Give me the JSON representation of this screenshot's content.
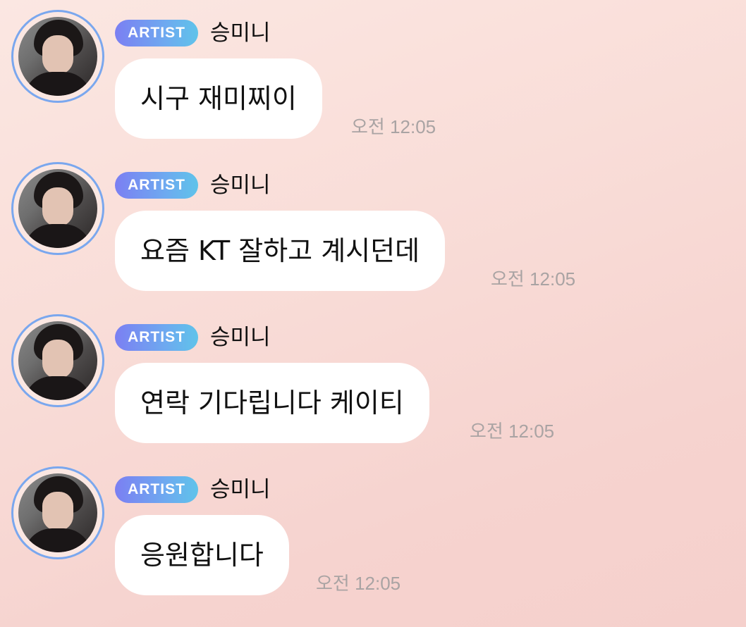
{
  "messages": [
    {
      "badge": "ARTIST",
      "sender": "승미니",
      "text": "시구 재미찌이",
      "time": "오전 12:05",
      "avatar_icon": "artist-avatar"
    },
    {
      "badge": "ARTIST",
      "sender": "승미니",
      "text": "요즘 KT 잘하고 계시던데",
      "time": "오전 12:05",
      "avatar_icon": "artist-avatar"
    },
    {
      "badge": "ARTIST",
      "sender": "승미니",
      "text": "연락 기다립니다 케이티",
      "time": "오전 12:05",
      "avatar_icon": "artist-avatar"
    },
    {
      "badge": "ARTIST",
      "sender": "승미니",
      "text": "응원합니다",
      "time": "오전 12:05",
      "avatar_icon": "artist-avatar"
    }
  ],
  "colors": {
    "background": "#f9ddd8",
    "bubble": "#ffffff",
    "badge_gradient_start": "#7b7ff2",
    "badge_gradient_end": "#5fc3ea",
    "avatar_ring": "#7aa7ee",
    "timestamp": "#a9a3a3"
  }
}
